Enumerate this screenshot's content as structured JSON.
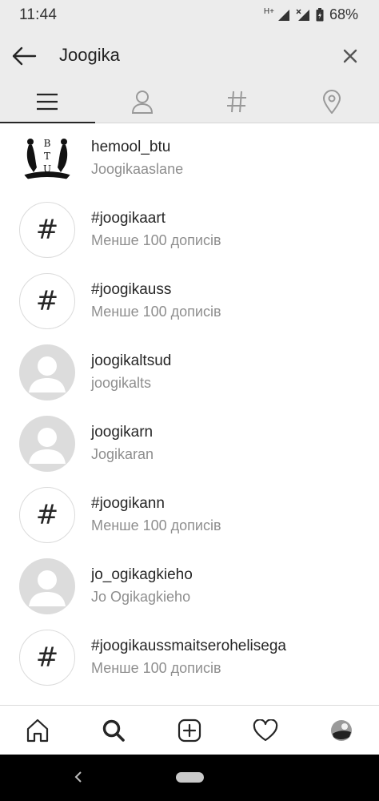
{
  "status_bar": {
    "time": "11:44",
    "network_label": "H+",
    "battery": "68%"
  },
  "search": {
    "query": "Joogika",
    "back_icon": "arrow-left-icon",
    "clear_icon": "close-icon"
  },
  "tabs": [
    {
      "name": "top",
      "icon": "list-icon",
      "active": true
    },
    {
      "name": "accounts",
      "icon": "person-icon",
      "active": false
    },
    {
      "name": "tags",
      "icon": "hashtag-icon",
      "active": false
    },
    {
      "name": "places",
      "icon": "location-pin-icon",
      "active": false
    }
  ],
  "results": [
    {
      "type": "account",
      "title": "hemool_btu",
      "subtitle": "Joogikaaslane",
      "avatar": "logo"
    },
    {
      "type": "hashtag",
      "title": "#joogikaart",
      "subtitle": "Менше 100 дописів",
      "avatar": "#"
    },
    {
      "type": "hashtag",
      "title": "#joogikauss",
      "subtitle": "Менше 100 дописів",
      "avatar": "#"
    },
    {
      "type": "account",
      "title": "joogikaltsud",
      "subtitle": "joogikalts",
      "avatar": "default"
    },
    {
      "type": "account",
      "title": "joogikarn",
      "subtitle": "Jogikaran",
      "avatar": "default"
    },
    {
      "type": "hashtag",
      "title": "#joogikann",
      "subtitle": "Менше 100 дописів",
      "avatar": "#"
    },
    {
      "type": "account",
      "title": "jo_ogikagkieho",
      "subtitle": "Jo Ogikagkieho",
      "avatar": "default"
    },
    {
      "type": "hashtag",
      "title": "#joogikaussmaitserohelisega",
      "subtitle": "Менше 100 дописів",
      "avatar": "#"
    }
  ],
  "bottom_nav": [
    {
      "name": "home",
      "icon": "home-icon"
    },
    {
      "name": "search",
      "icon": "search-icon"
    },
    {
      "name": "new-post",
      "icon": "add-post-icon"
    },
    {
      "name": "activity",
      "icon": "heart-icon"
    },
    {
      "name": "profile",
      "icon": "profile-avatar-icon"
    }
  ],
  "colors": {
    "header_bg": "#ececec",
    "text_primary": "#262626",
    "text_secondary": "#8e8e8e",
    "default_avatar": "#dcdcdc"
  }
}
